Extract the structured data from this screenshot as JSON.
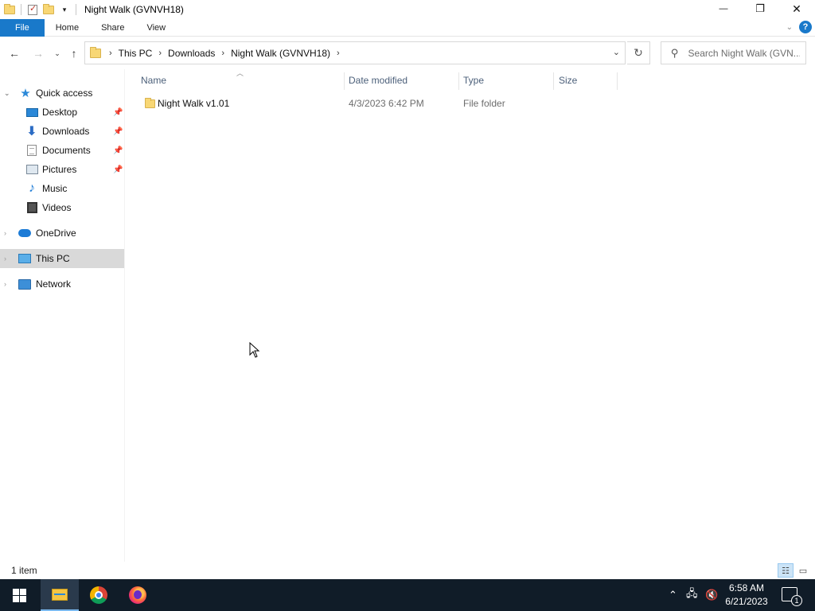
{
  "window": {
    "title": "Night Walk (GVNVH18)",
    "controls": {
      "minimize": "—",
      "restore": "❐",
      "close": "✕"
    }
  },
  "ribbon": {
    "tabs": [
      "File",
      "Home",
      "Share",
      "View"
    ],
    "help": "?"
  },
  "address": {
    "crumbs": [
      "This PC",
      "Downloads",
      "Night Walk (GVNVH18)"
    ],
    "separator": "›",
    "refresh": "↻"
  },
  "search": {
    "placeholder": "Search Night Walk (GVN..."
  },
  "navpane": {
    "quick_access": "Quick access",
    "items": [
      {
        "label": "Desktop",
        "icon": "desktop-icon",
        "pinned": true
      },
      {
        "label": "Downloads",
        "icon": "downloads-icon",
        "pinned": true
      },
      {
        "label": "Documents",
        "icon": "documents-icon",
        "pinned": true
      },
      {
        "label": "Pictures",
        "icon": "pictures-icon",
        "pinned": true
      },
      {
        "label": "Music",
        "icon": "music-icon",
        "pinned": false
      },
      {
        "label": "Videos",
        "icon": "videos-icon",
        "pinned": false
      }
    ],
    "onedrive": "OneDrive",
    "this_pc": "This PC",
    "network": "Network"
  },
  "columns": {
    "name": "Name",
    "date": "Date modified",
    "type": "Type",
    "size": "Size"
  },
  "files": [
    {
      "name": "Night Walk v1.01",
      "date": "4/3/2023 6:42 PM",
      "type": "File folder",
      "size": ""
    }
  ],
  "status": {
    "count": "1 item"
  },
  "taskbar": {
    "time": "6:58 AM",
    "date": "6/21/2023",
    "notification_count": "1"
  },
  "colors": {
    "accent": "#1979ca",
    "taskbar": "#101c28",
    "selection": "#d9d9d9"
  }
}
